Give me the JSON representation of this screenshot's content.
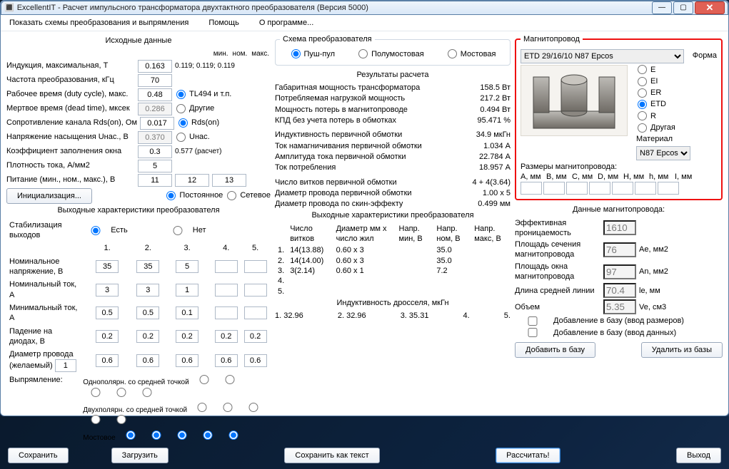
{
  "title": "ExcellentIT - Расчет импульсного трансформатора двухтактного преобразователя (Версия 5000)",
  "menu": {
    "schemes": "Показать схемы преобразования и выпрямления",
    "help": "Помощь",
    "about": "О программе..."
  },
  "col1": {
    "title": "Исходные данные",
    "minnommax": {
      "min": "мин.",
      "nom": "ном.",
      "max": "макс."
    },
    "rows": {
      "induk": {
        "l": "Индукция, максимальная, Т",
        "v": "0.163",
        "hint": "0.119; 0.119; 0.119"
      },
      "freq": {
        "l": "Частота преобразования, кГц",
        "v": "70"
      },
      "duty": {
        "l": "Рабочее время (duty cycle), макс.",
        "v": "0.48",
        "opt1": "TL494 и т.п."
      },
      "dead": {
        "l": "Мертвое время (dead time), мксек",
        "v": "0.286",
        "ro": true,
        "opt1": "Другие"
      },
      "rds": {
        "l": "Сопротивление канала Rds(on), Ом",
        "v": "0.017",
        "opt1": "Rds(on)"
      },
      "usat": {
        "l": "Напряжение насыщения Uнас., В",
        "v": "0.370",
        "ro": true,
        "opt1": "Uнас."
      },
      "kfill": {
        "l": "Коэффициент заполнения окна",
        "v": "0.3",
        "hint": "0.577 (расчет)"
      },
      "jdens": {
        "l": "Плотность тока, А/мм2",
        "v": "5"
      },
      "power": {
        "l": "Питание (мин., ном., макс.), В",
        "v1": "11",
        "v2": "12",
        "v3": "13"
      }
    },
    "init": "Инициализация...",
    "supply": {
      "const": "Постоянное",
      "net": "Сетевое"
    },
    "out_title": "Выходные характеристики преобразователя",
    "stab": {
      "l": "Стабилизация выходов",
      "yes": "Есть",
      "no": "Нет"
    },
    "cols": [
      "1.",
      "2.",
      "3.",
      "4.",
      "5."
    ],
    "nomV": {
      "l": "Номинальное напряжение, В",
      "v": [
        "35",
        "35",
        "5",
        "",
        ""
      ]
    },
    "nomI": {
      "l": "Номинальный ток, А",
      "v": [
        "3",
        "3",
        "1",
        "",
        ""
      ]
    },
    "minI": {
      "l": "Минимальный ток, А",
      "v": [
        "0.5",
        "0.5",
        "0.1",
        "",
        ""
      ]
    },
    "diod": {
      "l": "Падение на диодах, В",
      "v": [
        "0.2",
        "0.2",
        "0.2",
        "0.2",
        "0.2"
      ]
    },
    "wire": {
      "l": "Диаметр провода (желаемый)",
      "v0": "1",
      "v": [
        "0.6",
        "0.6",
        "0.6",
        "0.6",
        "0.6"
      ]
    },
    "rect": {
      "l": "Выпрямление:",
      "r1": "Однополярн. со средней точкой",
      "r2": "Двухполярн. со средней точкой",
      "r3": "Мостовое"
    },
    "save": "Сохранить",
    "load": "Загрузить"
  },
  "col2": {
    "scheme_title": "Схема преобразователя",
    "topo": {
      "push": "Пуш-пул",
      "half": "Полумостовая",
      "full": "Мостовая"
    },
    "res_title": "Результаты расчета",
    "r": {
      "ghab": {
        "l": "Габаритная мощность трансформатора",
        "v": "158.5 Вт"
      },
      "pload": {
        "l": "Потребляемая нагрузкой мощность",
        "v": "217.2 Вт"
      },
      "ploss": {
        "l": "Мощность потерь в магнитопроводе",
        "v": "0.494 Вт"
      },
      "eff": {
        "l": "КПД без учета потерь в обмотках",
        "v": "95.471 %"
      },
      "L1": {
        "l": "Индуктивность первичной обмотки",
        "v": "34.9 мкГн"
      },
      "Imag": {
        "l": "Ток намагничивания первичной обмотки",
        "v": "1.034 А"
      },
      "Iamp": {
        "l": "Амплитуда тока первичной обмотки",
        "v": "22.784 А"
      },
      "Iin": {
        "l": "Ток потребления",
        "v": "18.957 А"
      },
      "N1": {
        "l": "Число витков первичной обмотки",
        "v": "4 + 4(3.64)"
      },
      "D1": {
        "l": "Диаметр провода первичной обмотки",
        "v": "1.00 x 5"
      },
      "Dskin": {
        "l": "Диаметр провода по скин-эффекту",
        "v": "0.499 мм"
      }
    },
    "out_title": "Выходные характеристики преобразователя",
    "out_hdr": {
      "n": "Число\nвитков",
      "d": "Диаметр мм\nx число жил",
      "vmin": "Напр.\nмин, В",
      "vnom": "Напр.\nном, В",
      "vmax": "Напр.\nмакс, В"
    },
    "out_rows": [
      {
        "i": "1.",
        "n": "14(13.88)",
        "d": "0.60 x 3",
        "vn": "35.0"
      },
      {
        "i": "2.",
        "n": "14(14.00)",
        "d": "0.60 x 3",
        "vn": "35.0"
      },
      {
        "i": "3.",
        "n": "3(2.14)",
        "d": "0.60 x 1",
        "vn": "7.2"
      },
      {
        "i": "4."
      },
      {
        "i": "5."
      }
    ],
    "choke_title": "Индуктивность дросселя, мкГн",
    "choke": [
      "1. 32.96",
      "2. 32.96",
      "3. 35.31",
      "4.",
      "5."
    ],
    "savetxt": "Сохранить как текст",
    "calc": "Рассчитать!"
  },
  "col3": {
    "title": "Магнитопровод",
    "core": "ETD 29/16/10 N87 Epcos",
    "form": {
      "t": "Форма",
      "opts": [
        "E",
        "EI",
        "ER",
        "ETD",
        "R",
        "Другая"
      ],
      "sel": "ETD"
    },
    "material": {
      "t": "Материал",
      "v": "N87 Epcos"
    },
    "dims": {
      "t": "Размеры магнитопровода:",
      "hdr": [
        "A, мм",
        "B, мм",
        "C, мм",
        "D, мм",
        "H, мм",
        "h, мм",
        "I, мм"
      ]
    },
    "data_title": "Данные магнитопровода:",
    "mu": {
      "l": "Эффективная проницаемость",
      "v": "1610"
    },
    "ae": {
      "l": "Площадь сечения магнитопровода",
      "v": "76",
      "u": "Ae, мм2"
    },
    "an": {
      "l": "Площадь окна магнитопровода",
      "v": "97",
      "u": "An, мм2"
    },
    "le": {
      "l": "Длина средней линии",
      "v": "70.4",
      "u": "le, мм"
    },
    "ve": {
      "l": "Объем",
      "v": "5.35",
      "u": "Ve, см3"
    },
    "cb1": "Добавление в базу (ввод размеров)",
    "cb2": "Добавление в базу (ввод данных)",
    "add": "Добавить в базу",
    "del": "Удалить из базы",
    "exit": "Выход"
  }
}
